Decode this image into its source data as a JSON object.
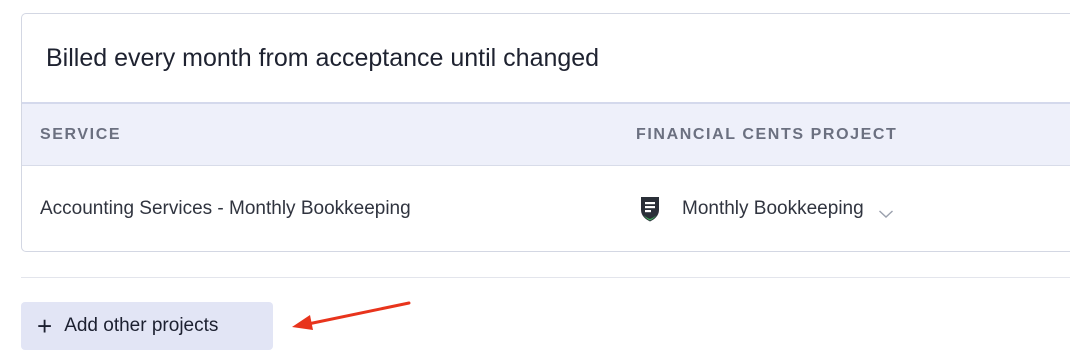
{
  "card": {
    "title": "Billed every month from acceptance until changed",
    "columns": [
      "SERVICE",
      "FINANCIAL CENTS PROJECT"
    ],
    "rows": [
      {
        "service": "Accounting Services - Monthly Bookkeeping",
        "project": "Monthly Bookkeeping",
        "project_icon": "financial-cents-shield-icon"
      }
    ]
  },
  "actions": {
    "add_label": "Add other projects",
    "add_icon": "plus-icon"
  },
  "annotation": {
    "arrow_color": "#e8341c",
    "arrow_icon": "red-arrow-icon"
  },
  "colors": {
    "header_bg": "#eef0fa",
    "button_bg": "#e2e5f5",
    "icon_green": "#3fae5a",
    "icon_dark": "#2a2f38"
  }
}
